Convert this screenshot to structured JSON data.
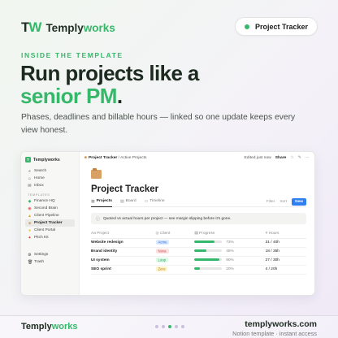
{
  "brand": {
    "mark_t": "T",
    "mark_w": "W",
    "name_a": "Temply",
    "name_b": "works"
  },
  "badge": {
    "label": "Project Tracker"
  },
  "hero": {
    "eyebrow": "INSIDE THE TEMPLATE",
    "line1": "Run projects like a",
    "line2_accent": "senior PM",
    "line2_end": ".",
    "subtitle": "Phases, deadlines and billable hours — linked so one update keeps every view honest."
  },
  "app": {
    "sidebar": {
      "workspace": "Templyworks",
      "top_items": [
        {
          "icon": "⌕",
          "label": "Search"
        },
        {
          "icon": "⌂",
          "label": "Home"
        },
        {
          "icon": "✉",
          "label": "Inbox"
        }
      ],
      "section_label": "TEMPLATES",
      "templates": [
        {
          "icon": "◆",
          "label": "Finance HQ",
          "color": "#35b86a"
        },
        {
          "icon": "◉",
          "label": "Second Brain",
          "color": "#e0565b"
        },
        {
          "icon": "▲",
          "label": "Client Pipeline",
          "color": "#e4a13b"
        },
        {
          "icon": "■",
          "label": "Project Tracker",
          "color": "#d9a066",
          "active": true
        },
        {
          "icon": "●",
          "label": "Client Portal",
          "color": "#e4c03b"
        },
        {
          "icon": "✦",
          "label": "Pitch Kit",
          "color": "#c4412f"
        }
      ],
      "bottom_items": [
        {
          "icon": "⚙",
          "label": "Settings"
        },
        {
          "icon": "🗑",
          "label": "Trash"
        }
      ]
    },
    "topbar": {
      "crumb_page": "Project Tracker",
      "crumb_rest": " / Active Projects",
      "edited": "Edited just now",
      "share": "Share"
    },
    "page": {
      "title": "Project Tracker",
      "tabs": [
        {
          "icon": "▦",
          "label": "Projects",
          "active": true
        },
        {
          "icon": "▤",
          "label": "Board"
        },
        {
          "icon": "▭",
          "label": "Timeline"
        }
      ],
      "filter": "Filter",
      "sort": "Sort",
      "new": "New",
      "callout": "Quoted vs actual hours per project — see margin slipping before it's gone."
    },
    "table": {
      "headers": [
        "Aa Project",
        "◎ Client",
        "▤ Progress",
        "# Hours"
      ],
      "rows": [
        {
          "project": "Website redesign",
          "client": "Acme",
          "client_bg": "#dbeafe",
          "client_fg": "#2563eb",
          "progress": 0.73,
          "progress_label": "73%",
          "hours": "31 / 40h"
        },
        {
          "project": "Brand identity",
          "client": "Nova",
          "client_bg": "#fde2e2",
          "client_fg": "#d04a4a",
          "progress": 0.45,
          "progress_label": "45%",
          "hours": "18 / 35h"
        },
        {
          "project": "UI system",
          "client": "Loop",
          "client_bg": "#dcfce7",
          "client_fg": "#1f9d55",
          "progress": 0.9,
          "progress_label": "90%",
          "hours": "27 / 30h"
        },
        {
          "project": "SEO sprint",
          "client": "Zero",
          "client_bg": "#fef3c7",
          "client_fg": "#b7791f",
          "progress": 0.2,
          "progress_label": "20%",
          "hours": "4 / 20h"
        }
      ]
    }
  },
  "footer": {
    "brand_a": "Temply",
    "brand_b": "works",
    "url": "templyworks.com",
    "note": "Notion template · instant access",
    "dots": [
      false,
      false,
      true,
      false,
      false
    ]
  },
  "colors": {
    "accent": "#35b86a",
    "primary_button": "#2f7ef2"
  }
}
